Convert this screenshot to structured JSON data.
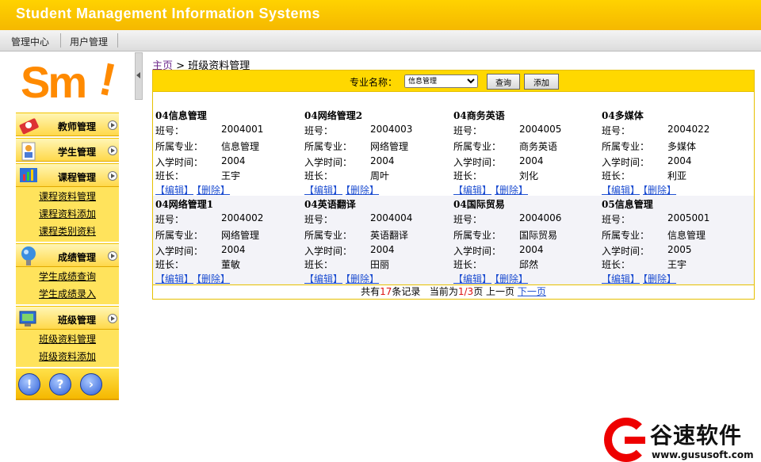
{
  "header": {
    "title": "Student Management Information Systems"
  },
  "topnav": {
    "items": [
      "管理中心",
      "用户管理"
    ]
  },
  "logo": {
    "text": "Sm",
    "mark": "!"
  },
  "sidebar": {
    "menus": [
      {
        "label": "教师管理",
        "icon": "teacher-icon"
      },
      {
        "label": "学生管理",
        "icon": "student-icon"
      },
      {
        "label": "课程管理",
        "icon": "course-icon",
        "subs": [
          "课程资料管理",
          "课程资料添加",
          "课程类别资料"
        ]
      },
      {
        "label": "成绩管理",
        "icon": "score-icon",
        "subs": [
          "学生成绩查询",
          "学生成绩录入"
        ]
      },
      {
        "label": "班级管理",
        "icon": "class-icon",
        "subs": [
          "班级资料管理",
          "班级资料添加"
        ]
      }
    ],
    "bottom_buttons": [
      {
        "name": "alert-icon",
        "glyph": "!"
      },
      {
        "name": "help-icon",
        "glyph": "?"
      },
      {
        "name": "forward-icon",
        "glyph": "›"
      }
    ]
  },
  "breadcrumb": {
    "home": "主页",
    "sep": " > ",
    "current": "班级资料管理"
  },
  "search": {
    "label": "专业名称：",
    "selected": "信息管理",
    "query_button": "查询",
    "add_button": "添加"
  },
  "field_labels": {
    "id": "班号：",
    "major": "所属专业：",
    "year": "入学时间：",
    "monitor": "班长：",
    "edit": "【编辑】",
    "delete": "【删除】"
  },
  "classes": [
    {
      "name": "04信息管理",
      "id": "2004001",
      "major": "信息管理",
      "year": "2004",
      "monitor": "王宇"
    },
    {
      "name": "04网络管理2",
      "id": "2004003",
      "major": "网络管理",
      "year": "2004",
      "monitor": "周叶"
    },
    {
      "name": "04商务英语",
      "id": "2004005",
      "major": "商务英语",
      "year": "2004",
      "monitor": "刘化"
    },
    {
      "name": "04多媒体",
      "id": "2004022",
      "major": "多媒体",
      "year": "2004",
      "monitor": "利亚"
    },
    {
      "name": "04网络管理1",
      "id": "2004002",
      "major": "网络管理",
      "year": "2004",
      "monitor": "董敏"
    },
    {
      "name": "04英语翻译",
      "id": "2004004",
      "major": "英语翻译",
      "year": "2004",
      "monitor": "田丽"
    },
    {
      "name": "04国际贸易",
      "id": "2004006",
      "major": "国际贸易",
      "year": "2004",
      "monitor": "邱然"
    },
    {
      "name": "05信息管理",
      "id": "2005001",
      "major": "信息管理",
      "year": "2005",
      "monitor": "王宇"
    }
  ],
  "pager": {
    "total_prefix": "共有",
    "total": "17",
    "total_suffix": "条记录",
    "current_prefix": "当前为",
    "current": "1/3",
    "current_suffix": "页",
    "prev": "上一页",
    "next": "下一页"
  },
  "watermark": {
    "brand": "谷速软件",
    "url": "www.gususoft.com"
  },
  "colors": {
    "header": "#ffd200",
    "accent_link": "#1f4fd1",
    "logo": "#ff8a00"
  }
}
